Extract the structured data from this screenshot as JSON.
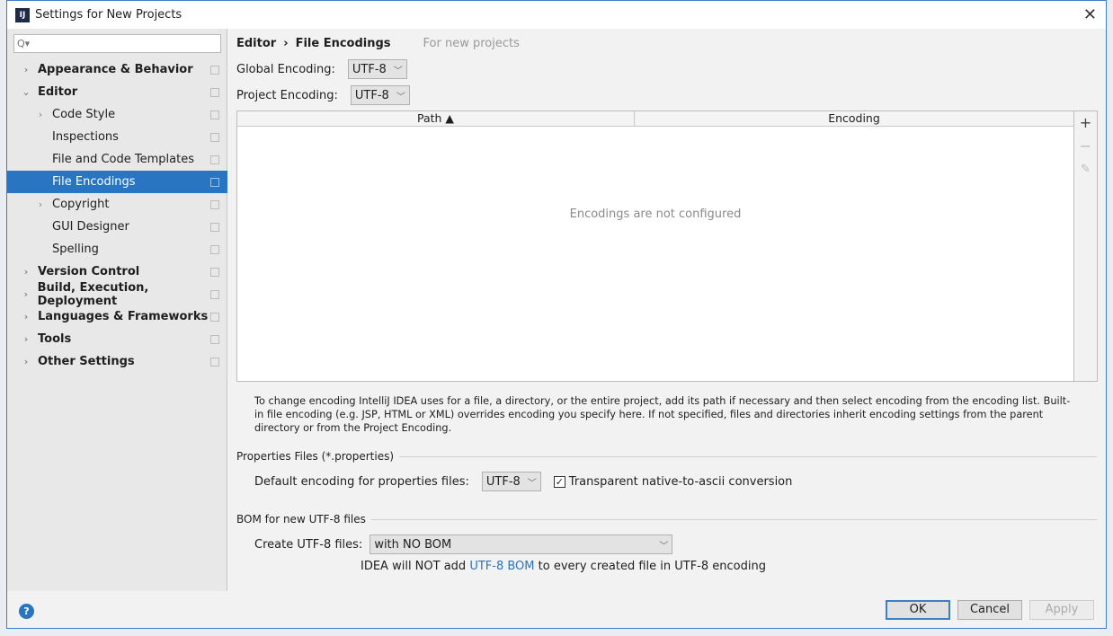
{
  "window": {
    "title": "Settings for New Projects",
    "app_icon": "IJ"
  },
  "sidebar": {
    "search_placeholder": "Q▾",
    "items": [
      {
        "label": "Appearance & Behavior",
        "bold": true,
        "arrow": "›",
        "level": 0
      },
      {
        "label": "Editor",
        "bold": true,
        "arrow": "⌄",
        "level": 0
      },
      {
        "label": "Code Style",
        "arrow": "›",
        "level": 1
      },
      {
        "label": "Inspections",
        "level": 1
      },
      {
        "label": "File and Code Templates",
        "level": 1
      },
      {
        "label": "File Encodings",
        "level": 1,
        "selected": true
      },
      {
        "label": "Copyright",
        "arrow": "›",
        "level": 1
      },
      {
        "label": "GUI Designer",
        "level": 1
      },
      {
        "label": "Spelling",
        "level": 1
      },
      {
        "label": "Version Control",
        "bold": true,
        "arrow": "›",
        "level": 0
      },
      {
        "label": "Build, Execution, Deployment",
        "bold": true,
        "arrow": "›",
        "level": 0
      },
      {
        "label": "Languages & Frameworks",
        "bold": true,
        "arrow": "›",
        "level": 0
      },
      {
        "label": "Tools",
        "bold": true,
        "arrow": "›",
        "level": 0
      },
      {
        "label": "Other Settings",
        "bold": true,
        "arrow": "›",
        "level": 0
      }
    ]
  },
  "breadcrumb": {
    "parent": "Editor",
    "sep": "›",
    "current": "File Encodings",
    "note": "For new projects"
  },
  "global": {
    "label": "Global Encoding:",
    "value": "UTF-8"
  },
  "project": {
    "label": "Project Encoding:",
    "value": "UTF-8"
  },
  "table": {
    "col_path": "Path ▲",
    "col_encoding": "Encoding",
    "empty": "Encodings are not configured",
    "add": "+",
    "remove": "−",
    "edit": "✎"
  },
  "help_text": "To change encoding IntelliJ IDEA uses for a file, a directory, or the entire project, add its path if necessary and then select encoding from the encoding list. Built-in file encoding (e.g. JSP, HTML or XML) overrides encoding you specify here. If not specified, files and directories inherit encoding settings from the parent directory or from the Project Encoding.",
  "properties": {
    "section": "Properties Files (*.properties)",
    "label": "Default encoding for properties files:",
    "value": "UTF-8",
    "checkbox": "Transparent native-to-ascii conversion",
    "checked": true
  },
  "bom": {
    "section": "BOM for new UTF-8 files",
    "label": "Create UTF-8 files:",
    "value": "with NO BOM",
    "note_pre": "IDEA will NOT add ",
    "note_link": "UTF-8 BOM",
    "note_post": " to every created file in UTF-8 encoding"
  },
  "footer": {
    "ok": "OK",
    "cancel": "Cancel",
    "apply": "Apply",
    "help": "?"
  },
  "colors": {
    "accent": "#2a75c1"
  }
}
